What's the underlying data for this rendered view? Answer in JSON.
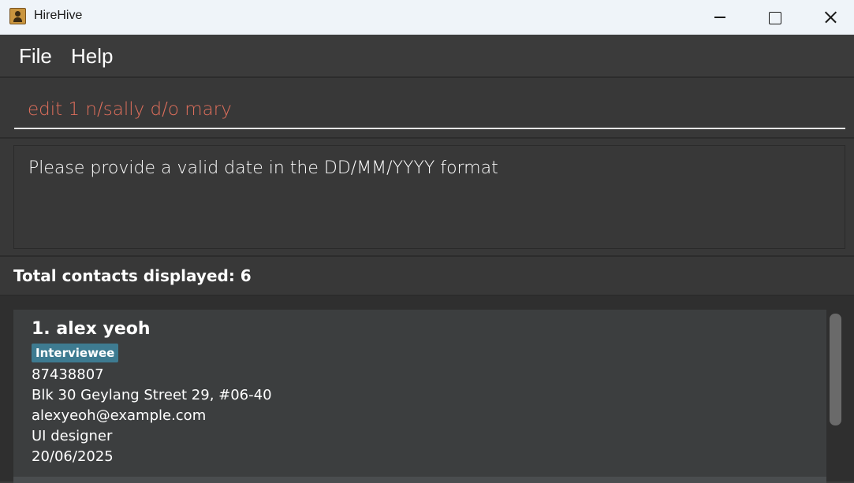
{
  "window": {
    "title": "HireHive"
  },
  "menu": {
    "file": "File",
    "help": "Help"
  },
  "command": {
    "value": "edit 1 n/sally d/o mary",
    "color": "#e06f5c"
  },
  "result": {
    "message": "Please provide a valid date in the DD/MM/YYYY format"
  },
  "status": {
    "contacts_count": "Total contacts displayed: 6"
  },
  "contacts": [
    {
      "name": "1. alex yeoh",
      "tag": "Interviewee",
      "phone": "87438807",
      "address": "Blk 30 Geylang Street 29, #06-40",
      "email": "alexyeoh@example.com",
      "role": "UI designer",
      "date": "20/06/2025"
    }
  ],
  "colors": {
    "tag_bg": "#3e7b91",
    "background": "#3b3b3b"
  }
}
